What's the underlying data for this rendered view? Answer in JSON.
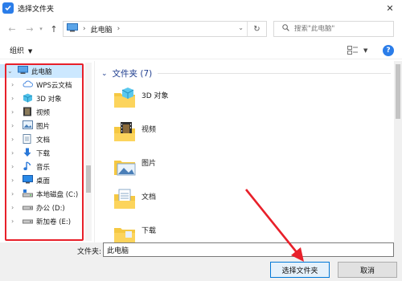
{
  "window": {
    "title": "选择文件夹",
    "close_glyph": "✕"
  },
  "address": {
    "back_glyph": "←",
    "forward_glyph": "→",
    "up_glyph": "↑",
    "separator": "›",
    "crumb": "此电脑",
    "crumb_chevron": "›",
    "dropdown_glyph": "⌄",
    "refresh_glyph": "↻"
  },
  "search": {
    "placeholder": "搜索\"此电脑\""
  },
  "toolbar": {
    "organize_label": "组织",
    "organize_caret": "▼",
    "help_glyph": "?"
  },
  "nav_tree": [
    {
      "label": "此电脑",
      "icon": "computer-icon",
      "expanded": true,
      "selected": true
    },
    {
      "label": "WPS云文档",
      "icon": "cloud-icon"
    },
    {
      "label": "3D 对象",
      "icon": "3d-objects-icon"
    },
    {
      "label": "视频",
      "icon": "video-icon"
    },
    {
      "label": "图片",
      "icon": "pictures-icon"
    },
    {
      "label": "文档",
      "icon": "documents-icon"
    },
    {
      "label": "下载",
      "icon": "downloads-icon"
    },
    {
      "label": "音乐",
      "icon": "music-icon"
    },
    {
      "label": "桌面",
      "icon": "desktop-icon"
    },
    {
      "label": "本地磁盘 (C:)",
      "icon": "local-disk-icon"
    },
    {
      "label": "办公 (D:)",
      "icon": "drive-icon"
    },
    {
      "label": "新加卷 (E:)",
      "icon": "drive-icon"
    }
  ],
  "content": {
    "group_label": "文件夹 (7)",
    "folders": [
      {
        "label": "3D 对象",
        "icon": "3d-folder-icon"
      },
      {
        "label": "视频",
        "icon": "video-folder-icon"
      },
      {
        "label": "图片",
        "icon": "pictures-folder-icon"
      },
      {
        "label": "文档",
        "icon": "documents-folder-icon"
      },
      {
        "label": "下载",
        "icon": "downloads-folder-icon"
      }
    ]
  },
  "bottom": {
    "filename_label": "文件夹:",
    "filename_value": "此电脑",
    "select_button": "选择文件夹",
    "cancel_button": "取消"
  },
  "colors": {
    "accent": "#2b7de9",
    "selection": "#cce8ff",
    "annotation_red": "#e8202a",
    "group_header": "#1e3d8f"
  }
}
